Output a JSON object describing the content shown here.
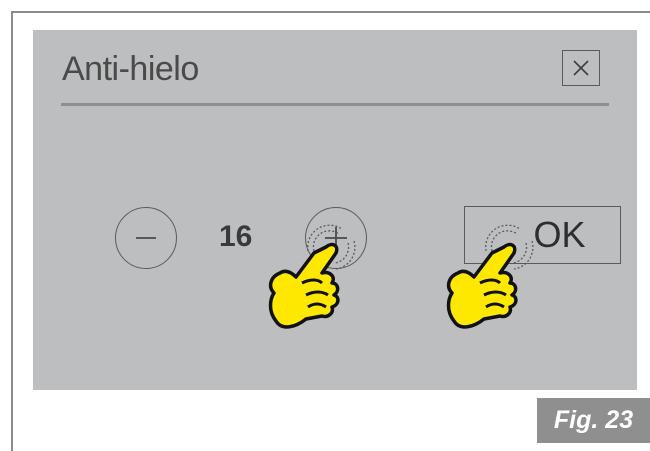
{
  "dialog": {
    "title": "Anti-hielo",
    "value": "16",
    "ok_label": "OK"
  },
  "icons": {
    "close": "close-icon",
    "minus": "minus-icon",
    "plus": "plus-icon",
    "hand": "pointing-hand-icon",
    "touch": "touch-ripple-icon"
  },
  "figure": {
    "label": "Fig. 23"
  },
  "colors": {
    "panel_background": "#bdbec0",
    "hand_fill": "#ffe800",
    "figure_label_background": "#8f8f8f"
  }
}
